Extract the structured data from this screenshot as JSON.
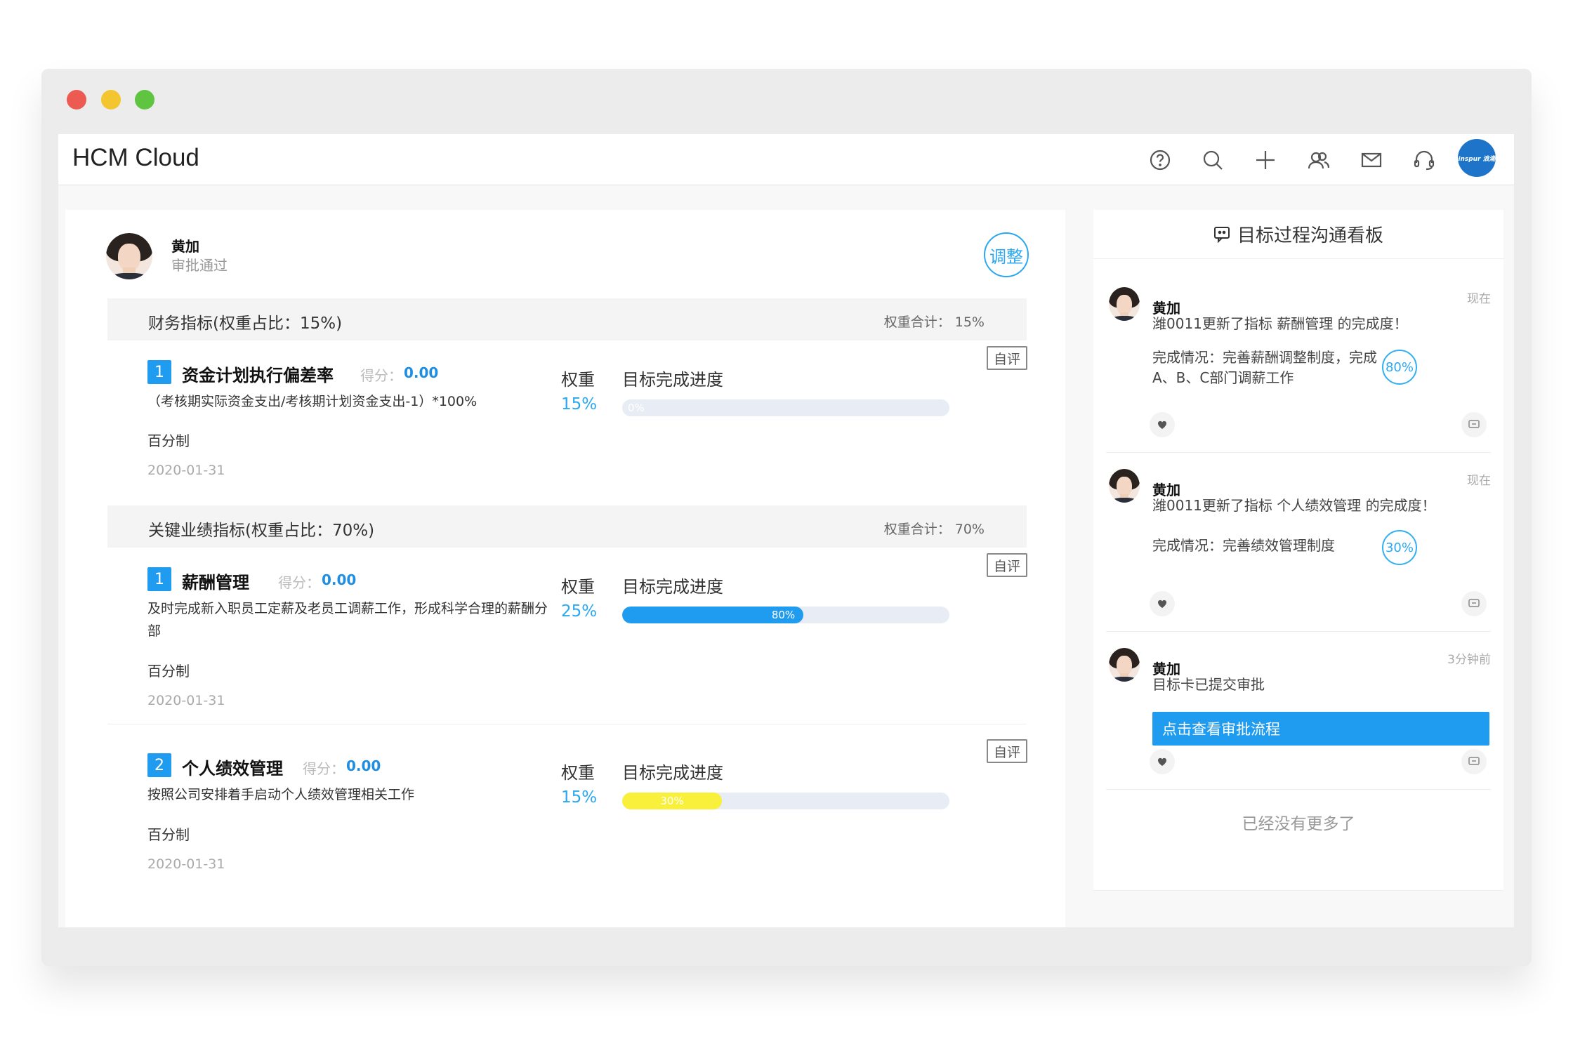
{
  "app": {
    "title": "HCM Cloud",
    "logo_text": "inspur 浪潮"
  },
  "toolbar_icons": [
    "help-icon",
    "search-icon",
    "add-icon",
    "contacts-icon",
    "mail-icon",
    "headset-icon"
  ],
  "employee": {
    "name": "黄加",
    "status": "审批通过",
    "adjust_label": "调整"
  },
  "labels": {
    "weight": "权重",
    "progress": "目标完成进度",
    "score": "得分：",
    "self_eval": "自评"
  },
  "groups": [
    {
      "title": "财务指标(权重占比：15%)",
      "total": "权重合计： 15%",
      "items": [
        {
          "num": "1",
          "title": "资金计划执行偏差率",
          "score": "0.00",
          "desc": "（考核期实际资金支出/考核期计划资金支出-1）*100%",
          "unit": "百分制",
          "date": "2020-01-31",
          "weight": "15%",
          "progress": 0,
          "progress_label": "0%",
          "color": "#e8ecf4"
        }
      ]
    },
    {
      "title": "关键业绩指标(权重占比：70%)",
      "total": "权重合计： 70%",
      "items": [
        {
          "num": "1",
          "title": "薪酬管理",
          "score": "0.00",
          "desc": "及时完成新入职员工定薪及老员工调薪工作，形成科学合理的薪酬分部",
          "unit": "百分制",
          "date": "2020-01-31",
          "weight": "25%",
          "progress": 80,
          "progress_label": "80%",
          "color": "#1f9cf0"
        },
        {
          "num": "2",
          "title": "个人绩效管理",
          "score": "0.00",
          "desc": "按照公司安排着手启动个人绩效管理相关工作",
          "unit": "百分制",
          "date": "2020-01-31",
          "weight": "15%",
          "progress": 30,
          "progress_label": "30%",
          "color": "#f8f03a"
        }
      ]
    }
  ],
  "board": {
    "title": "目标过程沟通看板",
    "feed": [
      {
        "name": "黄加",
        "time": "现在",
        "text": "潍0011更新了指标 薪酬管理 的完成度！",
        "detail": "完成情况：完善薪酬调整制度，完成A、B、C部门调薪工作",
        "percent": "80%"
      },
      {
        "name": "黄加",
        "time": "现在",
        "text": "潍0011更新了指标 个人绩效管理 的完成度！",
        "detail": "完成情况：完善绩效管理制度",
        "percent": "30%"
      },
      {
        "name": "黄加",
        "time": "3分钟前",
        "text": "目标卡已提交审批",
        "button": "点击查看审批流程"
      }
    ],
    "no_more": "已经没有更多了"
  }
}
